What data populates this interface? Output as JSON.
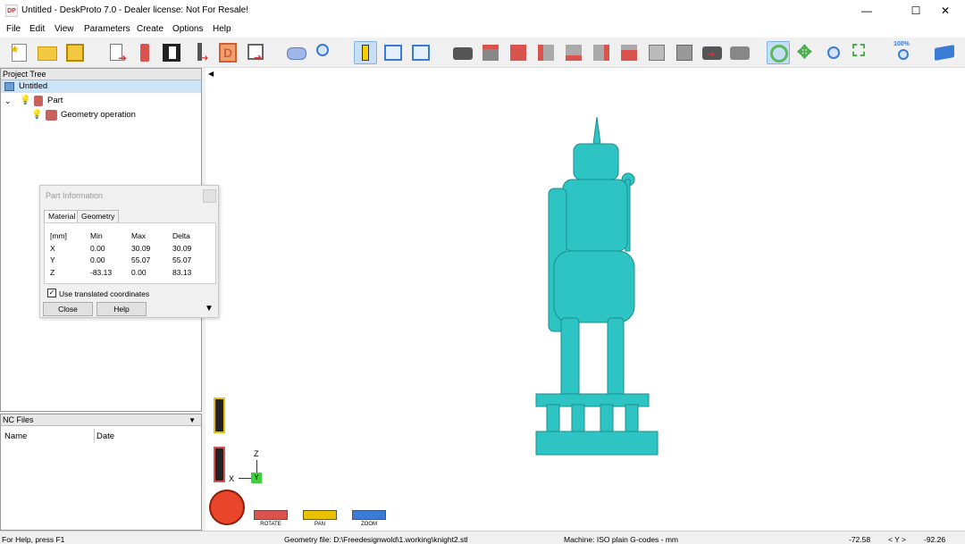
{
  "window": {
    "title": "Untitled - DeskProto 7.0 - Dealer license: Not For Resale!",
    "minimize_icon": "minimize-icon",
    "maximize_icon": "maximize-icon",
    "close_icon": "close-icon",
    "app_icon_text": "DP"
  },
  "menu": [
    "File",
    "Edit",
    "View",
    "Parameters",
    "Create",
    "Options",
    "Help"
  ],
  "toolbar": {
    "zoom_label": "100%"
  },
  "project_tree": {
    "header": "Project Tree",
    "root": "Untitled",
    "part": "Part",
    "operation": "Geometry operation"
  },
  "nc_files": {
    "header": "NC Files",
    "col_name": "Name",
    "col_date": "Date"
  },
  "part_info": {
    "title": "Part Information",
    "tabs": [
      "Material",
      "Geometry"
    ],
    "headers": [
      "[mm]",
      "Min",
      "Max",
      "Delta"
    ],
    "rows": [
      [
        "X",
        "0.00",
        "30.09",
        "30.09"
      ],
      [
        "Y",
        "0.00",
        "55.07",
        "55.07"
      ],
      [
        "Z",
        "-83.13",
        "0.00",
        "83.13"
      ]
    ],
    "checkbox_label": "Use translated coordinates",
    "close_btn": "Close",
    "help_btn": "Help"
  },
  "viewport": {
    "axis_z": "Z",
    "axis_x": "X",
    "axis_y": "Y",
    "rotate_label": "ROTATE",
    "pan_label": "PAN",
    "zoom_label": "ZOOM",
    "model_color": "#2ec4c4"
  },
  "status": {
    "help": "For Help, press F1",
    "geometry_file": "Geometry file: D:\\Freedesignwold\\1.working\\knight2.stl",
    "machine": "Machine: ISO plain G-codes - mm",
    "x": "-72.58",
    "axis": "< Y >",
    "y": "-92.26"
  }
}
